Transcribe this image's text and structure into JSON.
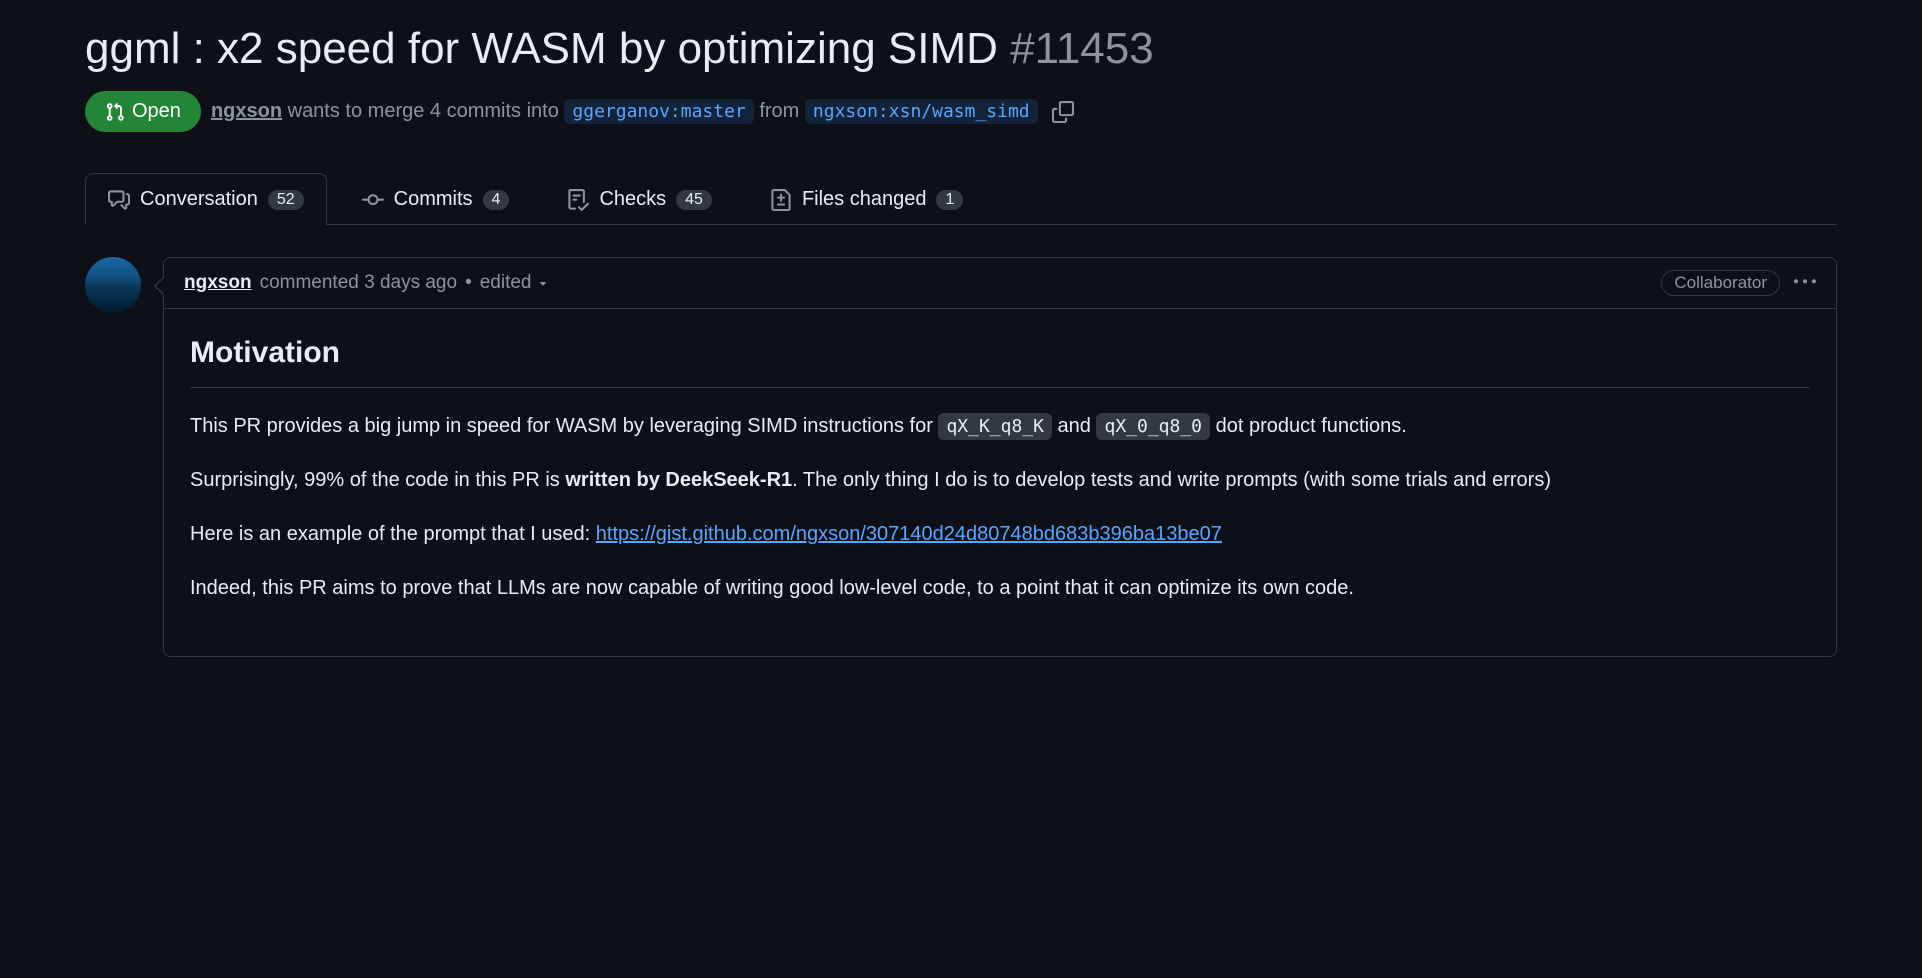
{
  "pr": {
    "title": "ggml : x2 speed for WASM by optimizing SIMD",
    "number": "#11453",
    "state": "Open",
    "author": "ngxson",
    "merge_text_1": " wants to merge 4 commits into ",
    "base_branch": "ggerganov:master",
    "from_text": " from ",
    "head_branch": "ngxson:xsn/wasm_simd"
  },
  "tabs": {
    "conversation": {
      "label": "Conversation",
      "count": "52"
    },
    "commits": {
      "label": "Commits",
      "count": "4"
    },
    "checks": {
      "label": "Checks",
      "count": "45"
    },
    "files": {
      "label": "Files changed",
      "count": "1"
    }
  },
  "comment": {
    "author": "ngxson",
    "meta": " commented 3 days ago",
    "dot": "•",
    "edited": "edited",
    "role": "Collaborator",
    "body": {
      "h2": "Motivation",
      "p1_a": "This PR provides a big jump in speed for WASM by leveraging SIMD instructions for ",
      "code1": "qX_K_q8_K",
      "p1_b": " and ",
      "code2": "qX_0_q8_0",
      "p1_c": " dot product functions.",
      "p2_a": "Surprisingly, 99% of the code in this PR is ",
      "p2_bold": "written by DeekSeek-R1",
      "p2_b": ". The only thing I do is to develop tests and write prompts (with some trials and errors)",
      "p3_a": "Here is an example of the prompt that I used: ",
      "p3_link": "https://gist.github.com/ngxson/307140d24d80748bd683b396ba13be07",
      "p4": "Indeed, this PR aims to prove that LLMs are now capable of writing good low-level code, to a point that it can optimize its own code."
    }
  }
}
